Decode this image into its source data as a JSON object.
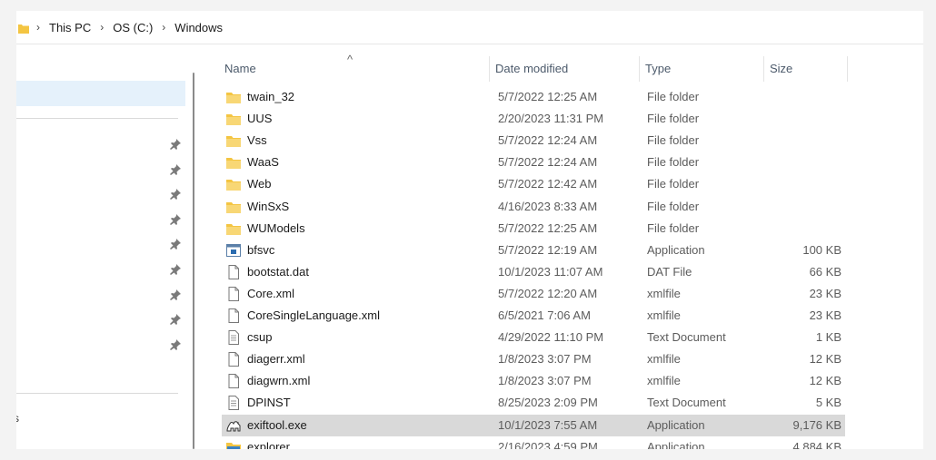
{
  "breadcrumb": {
    "items": [
      "This PC",
      "OS (C:)",
      "Windows"
    ],
    "separator": "›"
  },
  "columns": {
    "name": "Name",
    "date": "Date modified",
    "type": "Type",
    "size": "Size",
    "sort_indicator": "^"
  },
  "nav": {
    "partial_text": "s"
  },
  "files": [
    {
      "name": "twain_32",
      "date": "5/7/2022 12:25 AM",
      "type": "File folder",
      "size": "",
      "icon": "folder-icon"
    },
    {
      "name": "UUS",
      "date": "2/20/2023 11:31 PM",
      "type": "File folder",
      "size": "",
      "icon": "folder-icon"
    },
    {
      "name": "Vss",
      "date": "5/7/2022 12:24 AM",
      "type": "File folder",
      "size": "",
      "icon": "folder-icon"
    },
    {
      "name": "WaaS",
      "date": "5/7/2022 12:24 AM",
      "type": "File folder",
      "size": "",
      "icon": "folder-icon"
    },
    {
      "name": "Web",
      "date": "5/7/2022 12:42 AM",
      "type": "File folder",
      "size": "",
      "icon": "folder-icon"
    },
    {
      "name": "WinSxS",
      "date": "4/16/2023 8:33 AM",
      "type": "File folder",
      "size": "",
      "icon": "folder-icon"
    },
    {
      "name": "WUModels",
      "date": "5/7/2022 12:25 AM",
      "type": "File folder",
      "size": "",
      "icon": "folder-icon"
    },
    {
      "name": "bfsvc",
      "date": "5/7/2022 12:19 AM",
      "type": "Application",
      "size": "100 KB",
      "icon": "application-icon"
    },
    {
      "name": "bootstat.dat",
      "date": "10/1/2023 11:07 AM",
      "type": "DAT File",
      "size": "66 KB",
      "icon": "file-icon"
    },
    {
      "name": "Core.xml",
      "date": "5/7/2022 12:20 AM",
      "type": "xmlfile",
      "size": "23 KB",
      "icon": "file-icon"
    },
    {
      "name": "CoreSingleLanguage.xml",
      "date": "6/5/2021 7:06 AM",
      "type": "xmlfile",
      "size": "23 KB",
      "icon": "file-icon"
    },
    {
      "name": "csup",
      "date": "4/29/2022 11:10 PM",
      "type": "Text Document",
      "size": "1 KB",
      "icon": "text-document-icon"
    },
    {
      "name": "diagerr.xml",
      "date": "1/8/2023 3:07 PM",
      "type": "xmlfile",
      "size": "12 KB",
      "icon": "file-icon"
    },
    {
      "name": "diagwrn.xml",
      "date": "1/8/2023 3:07 PM",
      "type": "xmlfile",
      "size": "12 KB",
      "icon": "file-icon"
    },
    {
      "name": "DPINST",
      "date": "8/25/2023 2:09 PM",
      "type": "Text Document",
      "size": "5 KB",
      "icon": "text-document-icon"
    },
    {
      "name": "exiftool.exe",
      "date": "10/1/2023 7:55 AM",
      "type": "Application",
      "size": "9,176 KB",
      "icon": "exiftool-camel-icon",
      "selected": true
    },
    {
      "name": "explorer",
      "date": "2/16/2023 4:59 PM",
      "type": "Application",
      "size": "4,884 KB",
      "icon": "explorer-icon"
    }
  ],
  "colors": {
    "folder": "#f4c542",
    "selection": "#d9d9d9",
    "nav_selection": "#e5f1fb"
  }
}
